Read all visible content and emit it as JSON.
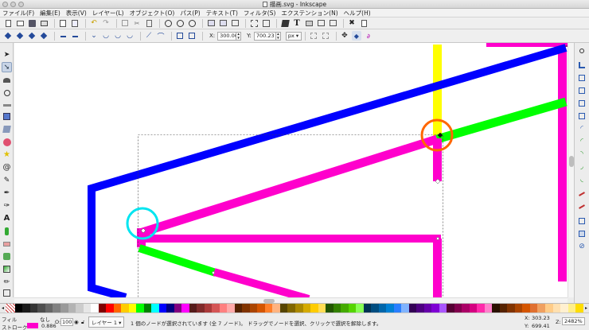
{
  "window": {
    "title": "描画.svg - Inkscape"
  },
  "menu": [
    "ファイル(F)",
    "編集(E)",
    "表示(V)",
    "レイヤー(L)",
    "オブジェクト(O)",
    "パス(P)",
    "テキスト(T)",
    "フィルタ(S)",
    "エクステンション(N)",
    "ヘルプ(H)"
  ],
  "controls": {
    "x_label": "X:",
    "x_value": "300.00",
    "y_label": "Y:",
    "y_value": "700.23",
    "unit": "px"
  },
  "status": {
    "fill_label": "フィル",
    "fill_value": "なし",
    "stroke_label": "ストローク",
    "stroke_width": "0.886",
    "opacity_label": "O:",
    "opacity_value": "100",
    "layer_name": "レイヤー 1",
    "message": "1 個のノードが選択されています (全 7 ノード)。 ドラッグでノードを選択、クリックで選択を解除します。",
    "cursor_x_label": "X:",
    "cursor_x": "303.23",
    "cursor_y_label": "Y:",
    "cursor_y": "699.41",
    "zoom_label": "Z:",
    "zoom": "2482%"
  },
  "colors": {
    "blue": "#0000ff",
    "magenta": "#ff00cc",
    "green": "#00ff00",
    "yellow": "#ffff00",
    "cyan_circle": "#00e5f0",
    "orange_circle": "#ff6600",
    "stroke_swatch": "#ff00cc"
  },
  "palette": [
    "#000000",
    "#1a1a1a",
    "#333333",
    "#4d4d4d",
    "#666666",
    "#808080",
    "#999999",
    "#b3b3b3",
    "#cccccc",
    "#e6e6e6",
    "#ffffff",
    "#800000",
    "#ff0000",
    "#ff6600",
    "#ffcc00",
    "#ffff00",
    "#00ff00",
    "#008000",
    "#00ffff",
    "#0000ff",
    "#000080",
    "#800080",
    "#ff00ff",
    "#551a1a",
    "#7f2a2a",
    "#aa3a3a",
    "#d45555",
    "#ff8080",
    "#ffaaaa",
    "#552200",
    "#803300",
    "#aa4400",
    "#d45500",
    "#ff7f2a",
    "#ffb380",
    "#554400",
    "#806600",
    "#aa8800",
    "#d4aa00",
    "#ffcc00",
    "#ffdd55",
    "#225500",
    "#338000",
    "#44aa00",
    "#55d400",
    "#88ff55",
    "#003355",
    "#004d80",
    "#0066aa",
    "#0080d4",
    "#2a7fff",
    "#80b3ff",
    "#330055",
    "#4d0080",
    "#6600aa",
    "#7f00d4",
    "#aa55ff",
    "#550033",
    "#80004d",
    "#aa0066",
    "#d40080",
    "#ff2aaa",
    "#ff80cc",
    "#2b1100",
    "#552200",
    "#803300",
    "#aa4400",
    "#d45500",
    "#e07030",
    "#f0a060",
    "#ffcc88",
    "#ffe0b0",
    "#fff0d0",
    "#ffee88",
    "#ffdd00"
  ]
}
